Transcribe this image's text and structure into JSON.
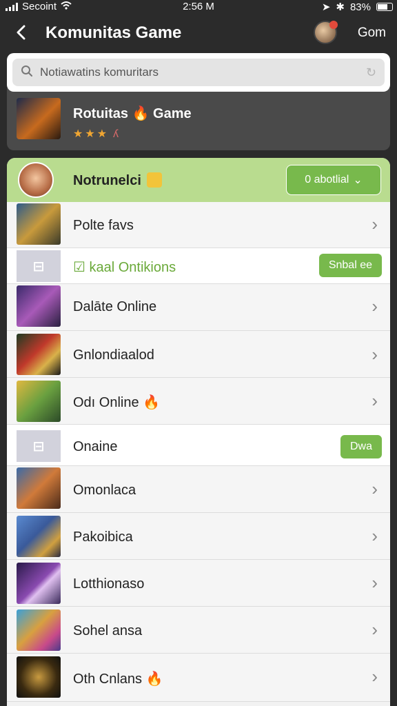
{
  "status_bar": {
    "carrier": "Secoint",
    "time": "2:56 M",
    "battery": "83%"
  },
  "nav": {
    "title": "Komunitas Game",
    "right_label": "Gom"
  },
  "search": {
    "placeholder": "Notiawatins komuritars"
  },
  "featured": {
    "title": "Rotuitas",
    "title_suffix": "Game",
    "stars": "★★★",
    "rating_mark": "ʎ"
  },
  "community": {
    "title": "Notrunelci",
    "button_label": "0 abotlial"
  },
  "rows": {
    "r1": {
      "label": "Polte favs"
    },
    "s1": {
      "label": "kaal Ontikions",
      "button": "Snbal ee"
    },
    "r2": {
      "label": "Dalāte Online"
    },
    "r3": {
      "label": "Gnlondiaalod"
    },
    "r4": {
      "label": "Odı Online"
    },
    "s2": {
      "label": "Onaine",
      "button": "Dwa"
    },
    "r5": {
      "label": "Omonlaca"
    },
    "r6": {
      "label": "Pakoibica"
    },
    "r7": {
      "label": "Lotthionaso"
    },
    "r8": {
      "label": "Sohel ansa"
    },
    "r9": {
      "label": "Oth Cnlans"
    }
  },
  "colors": {
    "accent_green": "#78b94c",
    "header_green": "#b9dc8f",
    "background_dark": "#2b2b2b"
  }
}
